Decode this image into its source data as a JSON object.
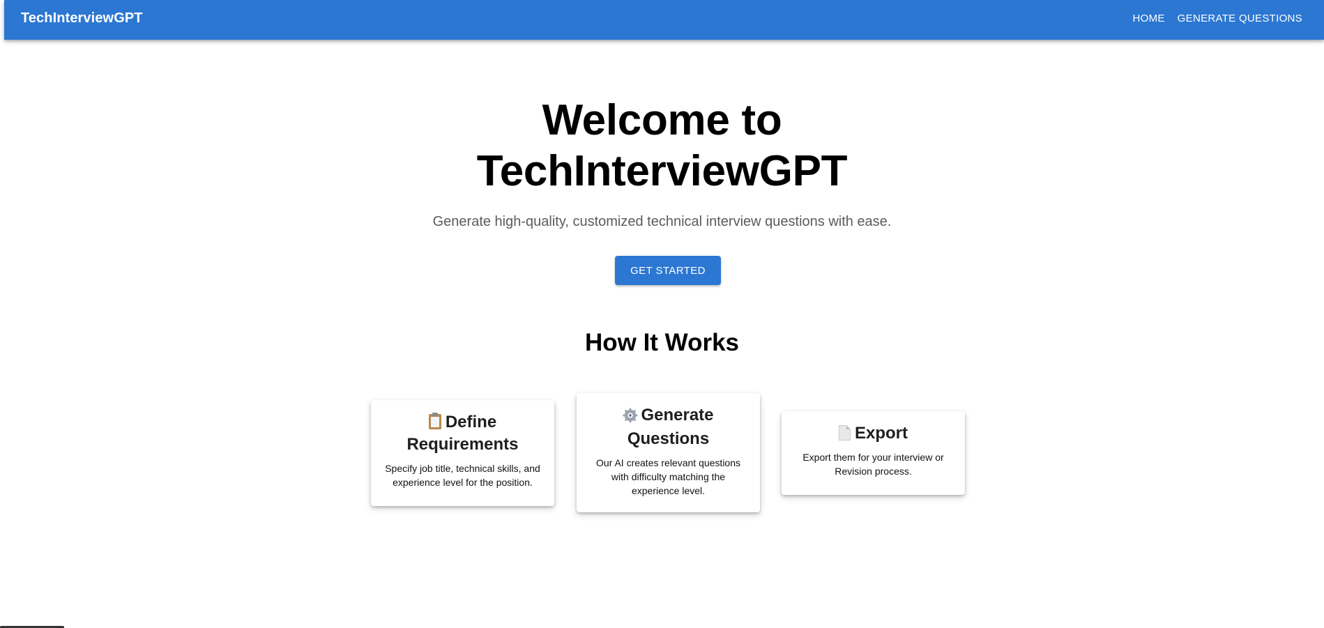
{
  "header": {
    "brand": "TechInterviewGPT",
    "nav": [
      {
        "label": "HOME"
      },
      {
        "label": "GENERATE QUESTIONS"
      }
    ],
    "color": "#2c77d2"
  },
  "hero": {
    "title_line1": "Welcome to",
    "title_line2": "TechInterviewGPT",
    "subtitle": "Generate high-quality, customized technical interview questions with ease.",
    "cta_label": "GET STARTED"
  },
  "how_it_works": {
    "title": "How It Works",
    "cards": [
      {
        "icon": "clipboard-icon",
        "glyph": "📋",
        "title": "Define Requirements",
        "text": "Specify job title, technical skills, and experience level for the position."
      },
      {
        "icon": "gear-icon",
        "glyph": "⚙️",
        "title": "Generate Questions",
        "text": "Our AI creates relevant questions with difficulty matching the experience level."
      },
      {
        "icon": "document-icon",
        "glyph": "📄",
        "title": "Export",
        "text": "Export them for your interview or Revision process."
      }
    ]
  }
}
